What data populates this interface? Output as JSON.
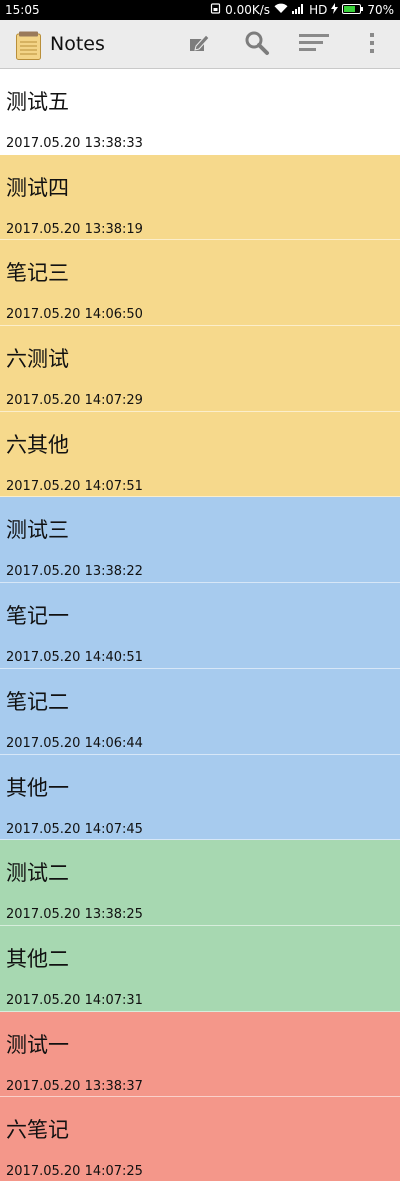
{
  "status_bar": {
    "time": "15:05",
    "speed": "0.00K/s",
    "hd": "HD",
    "battery": "70%",
    "icons": [
      "sim-icon",
      "wifi-icon",
      "signal-icon",
      "charging-icon",
      "battery-icon"
    ]
  },
  "toolbar": {
    "title": "Notes",
    "icons": [
      "notes-app-icon",
      "new-note-icon",
      "search-icon",
      "sort-icon",
      "more-options-icon"
    ]
  },
  "colors": {
    "white": "#ffffff",
    "yellow": "#f6d98c",
    "blue": "#a7cbee",
    "green": "#a7d8b1",
    "red": "#f4978a"
  },
  "notes": [
    {
      "title": "测试五",
      "date": "2017.05.20 13:38:33",
      "color": "white"
    },
    {
      "title": "测试四",
      "date": "2017.05.20 13:38:19",
      "color": "yellow"
    },
    {
      "title": "笔记三",
      "date": "2017.05.20 14:06:50",
      "color": "yellow"
    },
    {
      "title": "六测试",
      "date": "2017.05.20 14:07:29",
      "color": "yellow"
    },
    {
      "title": "六其他",
      "date": "2017.05.20 14:07:51",
      "color": "yellow"
    },
    {
      "title": "测试三",
      "date": "2017.05.20 13:38:22",
      "color": "blue"
    },
    {
      "title": "笔记一",
      "date": "2017.05.20 14:40:51",
      "color": "blue"
    },
    {
      "title": "笔记二",
      "date": "2017.05.20 14:06:44",
      "color": "blue"
    },
    {
      "title": "其他一",
      "date": "2017.05.20 14:07:45",
      "color": "blue"
    },
    {
      "title": "测试二",
      "date": "2017.05.20 13:38:25",
      "color": "green"
    },
    {
      "title": "其他二",
      "date": "2017.05.20 14:07:31",
      "color": "green"
    },
    {
      "title": "测试一",
      "date": "2017.05.20 13:38:37",
      "color": "red"
    },
    {
      "title": "六笔记",
      "date": "2017.05.20 14:07:25",
      "color": "red"
    }
  ]
}
